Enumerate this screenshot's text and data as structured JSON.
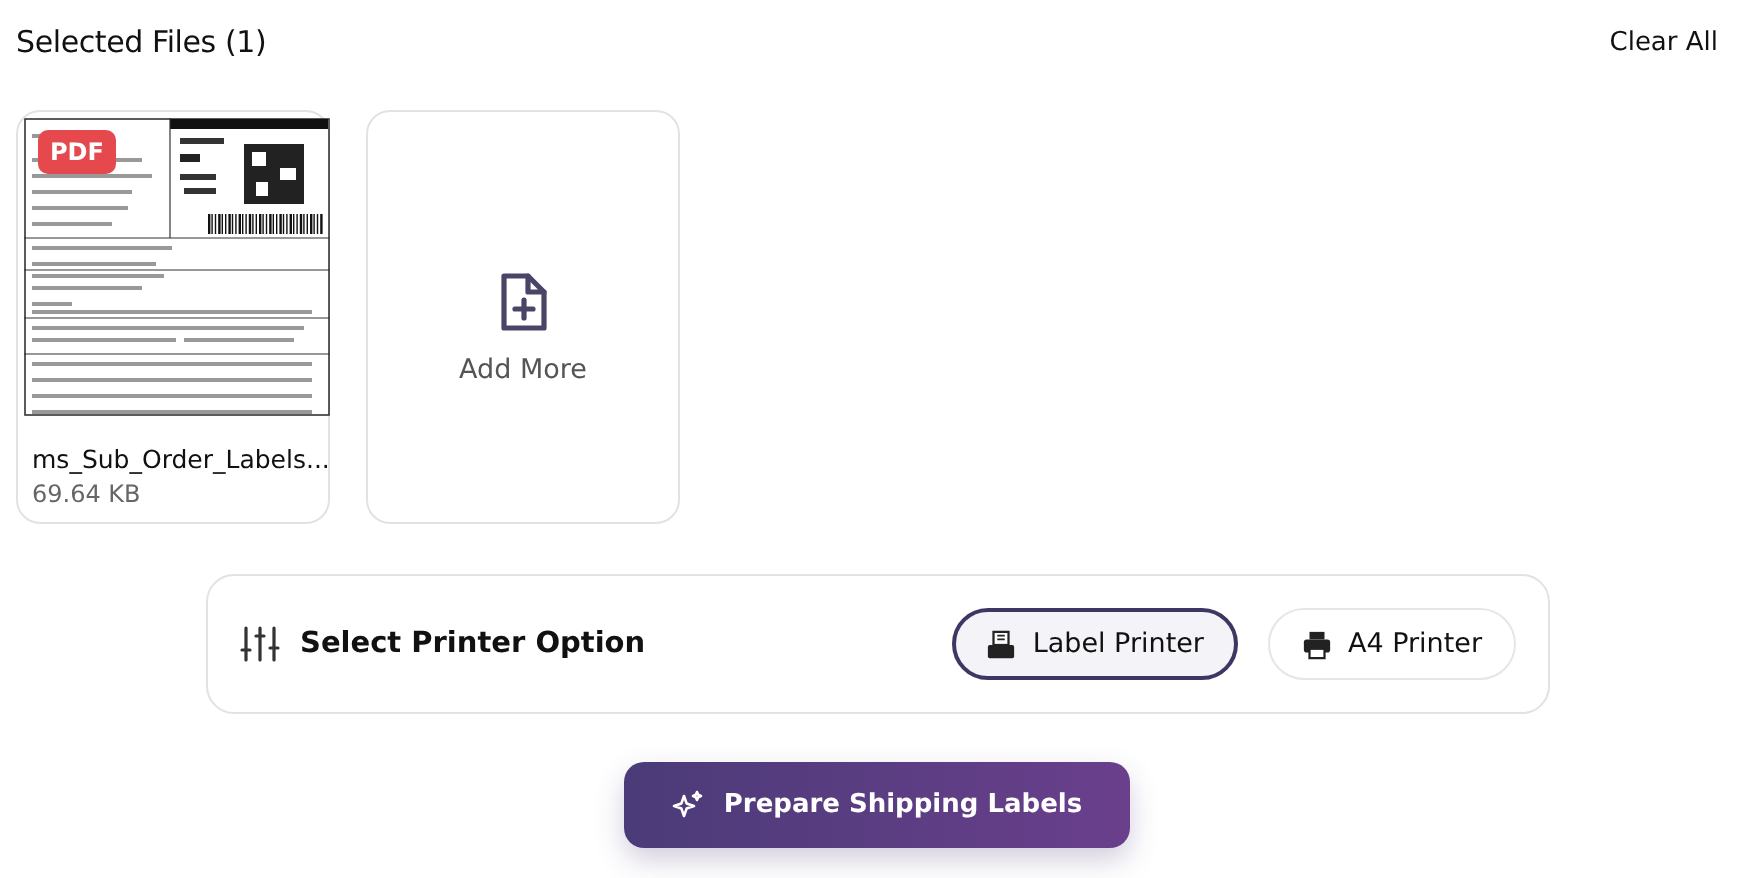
{
  "header": {
    "title": "Selected Files (1)",
    "action": "Clear All"
  },
  "files": [
    {
      "badge": "PDF",
      "name": "ms_Sub_Order_Labels...",
      "size": "69.64 KB"
    }
  ],
  "add_more": {
    "label": "Add More"
  },
  "printer": {
    "title": "Select Printer Option",
    "options": [
      {
        "kind": "label",
        "label": "Label Printer",
        "selected": true
      },
      {
        "kind": "a4",
        "label": "A4 Printer",
        "selected": false
      }
    ]
  },
  "primary_button": {
    "label": "Prepare Shipping Labels"
  }
}
